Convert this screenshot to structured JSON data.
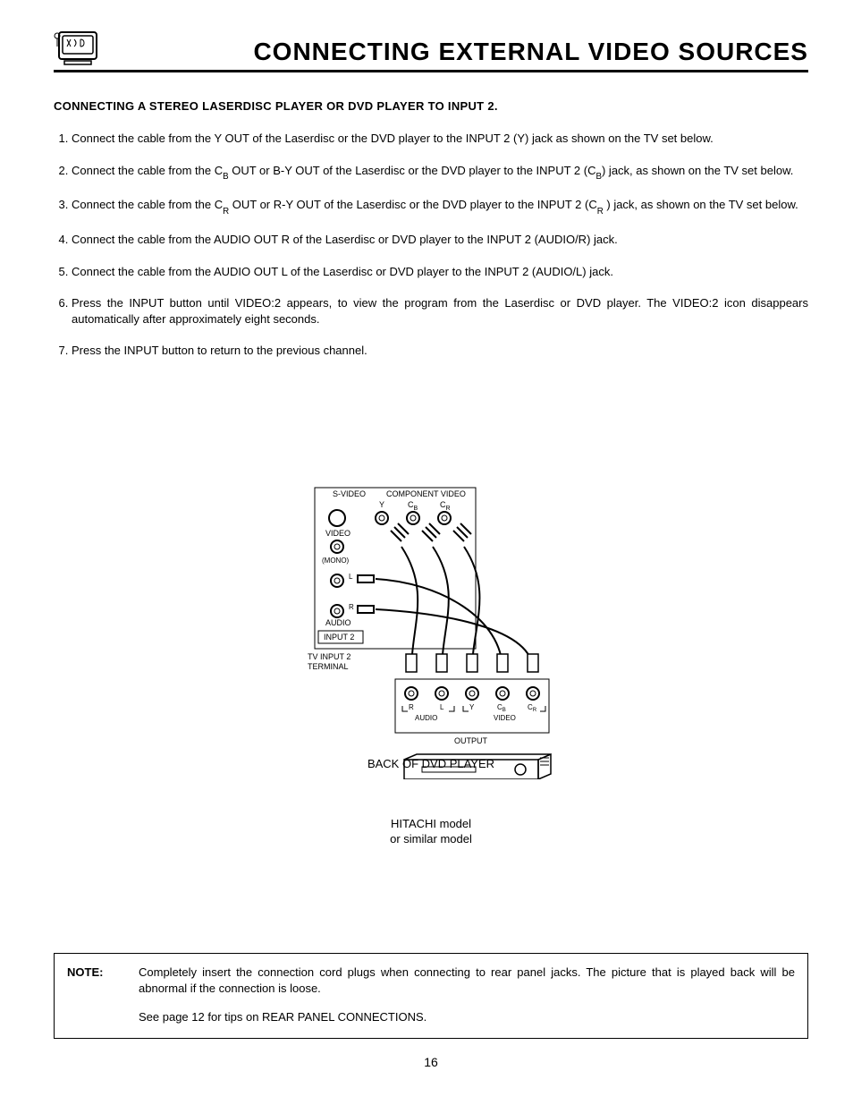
{
  "header": {
    "title": "CONNECTING EXTERNAL VIDEO SOURCES"
  },
  "section_title": "CONNECTING A STEREO LASERDISC PLAYER OR DVD PLAYER TO INPUT 2.",
  "steps": [
    {
      "pre": "Connect  the cable from the Y OUT of the Laserdisc or the DVD player to the INPUT 2 (Y) jack as shown on the TV set below."
    },
    {
      "pre": "Connect the cable from the C",
      "sub1": "B",
      "mid": "  OUT or B-Y OUT of the Laserdisc or the DVD player to the INPUT 2 (C",
      "sub2": "B",
      "post": ") jack, as shown on the TV set below."
    },
    {
      "pre": "Connect the cable from the C",
      "sub1": "R",
      "mid": " OUT or R-Y OUT of the Laserdisc or the DVD player to the INPUT 2 (C",
      "sub2": "R",
      "post": " ) jack, as shown on the TV set below."
    },
    {
      "pre": "Connect the cable from the AUDIO OUT R of the Laserdisc or DVD player to the INPUT 2 (AUDIO/R) jack."
    },
    {
      "pre": "Connect the cable from the AUDIO OUT L of the Laserdisc or DVD player to the INPUT 2 (AUDIO/L) jack."
    },
    {
      "pre": "Press the INPUT button until VIDEO:2 appears, to view the program from the Laserdisc or DVD player.  The VIDEO:2 icon disappears automatically after approximately eight seconds."
    },
    {
      "pre": "Press the INPUT button to return to the previous channel."
    }
  ],
  "diagram": {
    "top_labels": {
      "svideo": "S-VIDEO",
      "component": "COMPONENT VIDEO",
      "y": "Y",
      "cb": "C",
      "cb_sub": "B",
      "cr": "C",
      "cr_sub": "R"
    },
    "left_labels": {
      "video": "VIDEO",
      "mono": "(MONO)",
      "l": "L",
      "r": "R",
      "audio": "AUDIO",
      "input2": "INPUT 2",
      "terminal": "TV INPUT 2\nTERMINAL"
    },
    "bottom_labels": {
      "r": "R",
      "l": "L",
      "y": "Y",
      "cb": "C",
      "cb_sub": "B",
      "cr": "C",
      "cr_sub": "R",
      "audio": "AUDIO",
      "video": "VIDEO",
      "output": "OUTPUT"
    },
    "back_label": "BACK OF DVD PLAYER",
    "model_line1": "HITACHI model",
    "model_line2": "or similar model"
  },
  "note": {
    "label": "NOTE:",
    "text1": "Completely insert the connection cord plugs when connecting to rear panel jacks.  The picture that is played back will be abnormal if the connection is loose.",
    "text2": "See page 12 for tips on REAR PANEL CONNECTIONS."
  },
  "page_number": "16"
}
